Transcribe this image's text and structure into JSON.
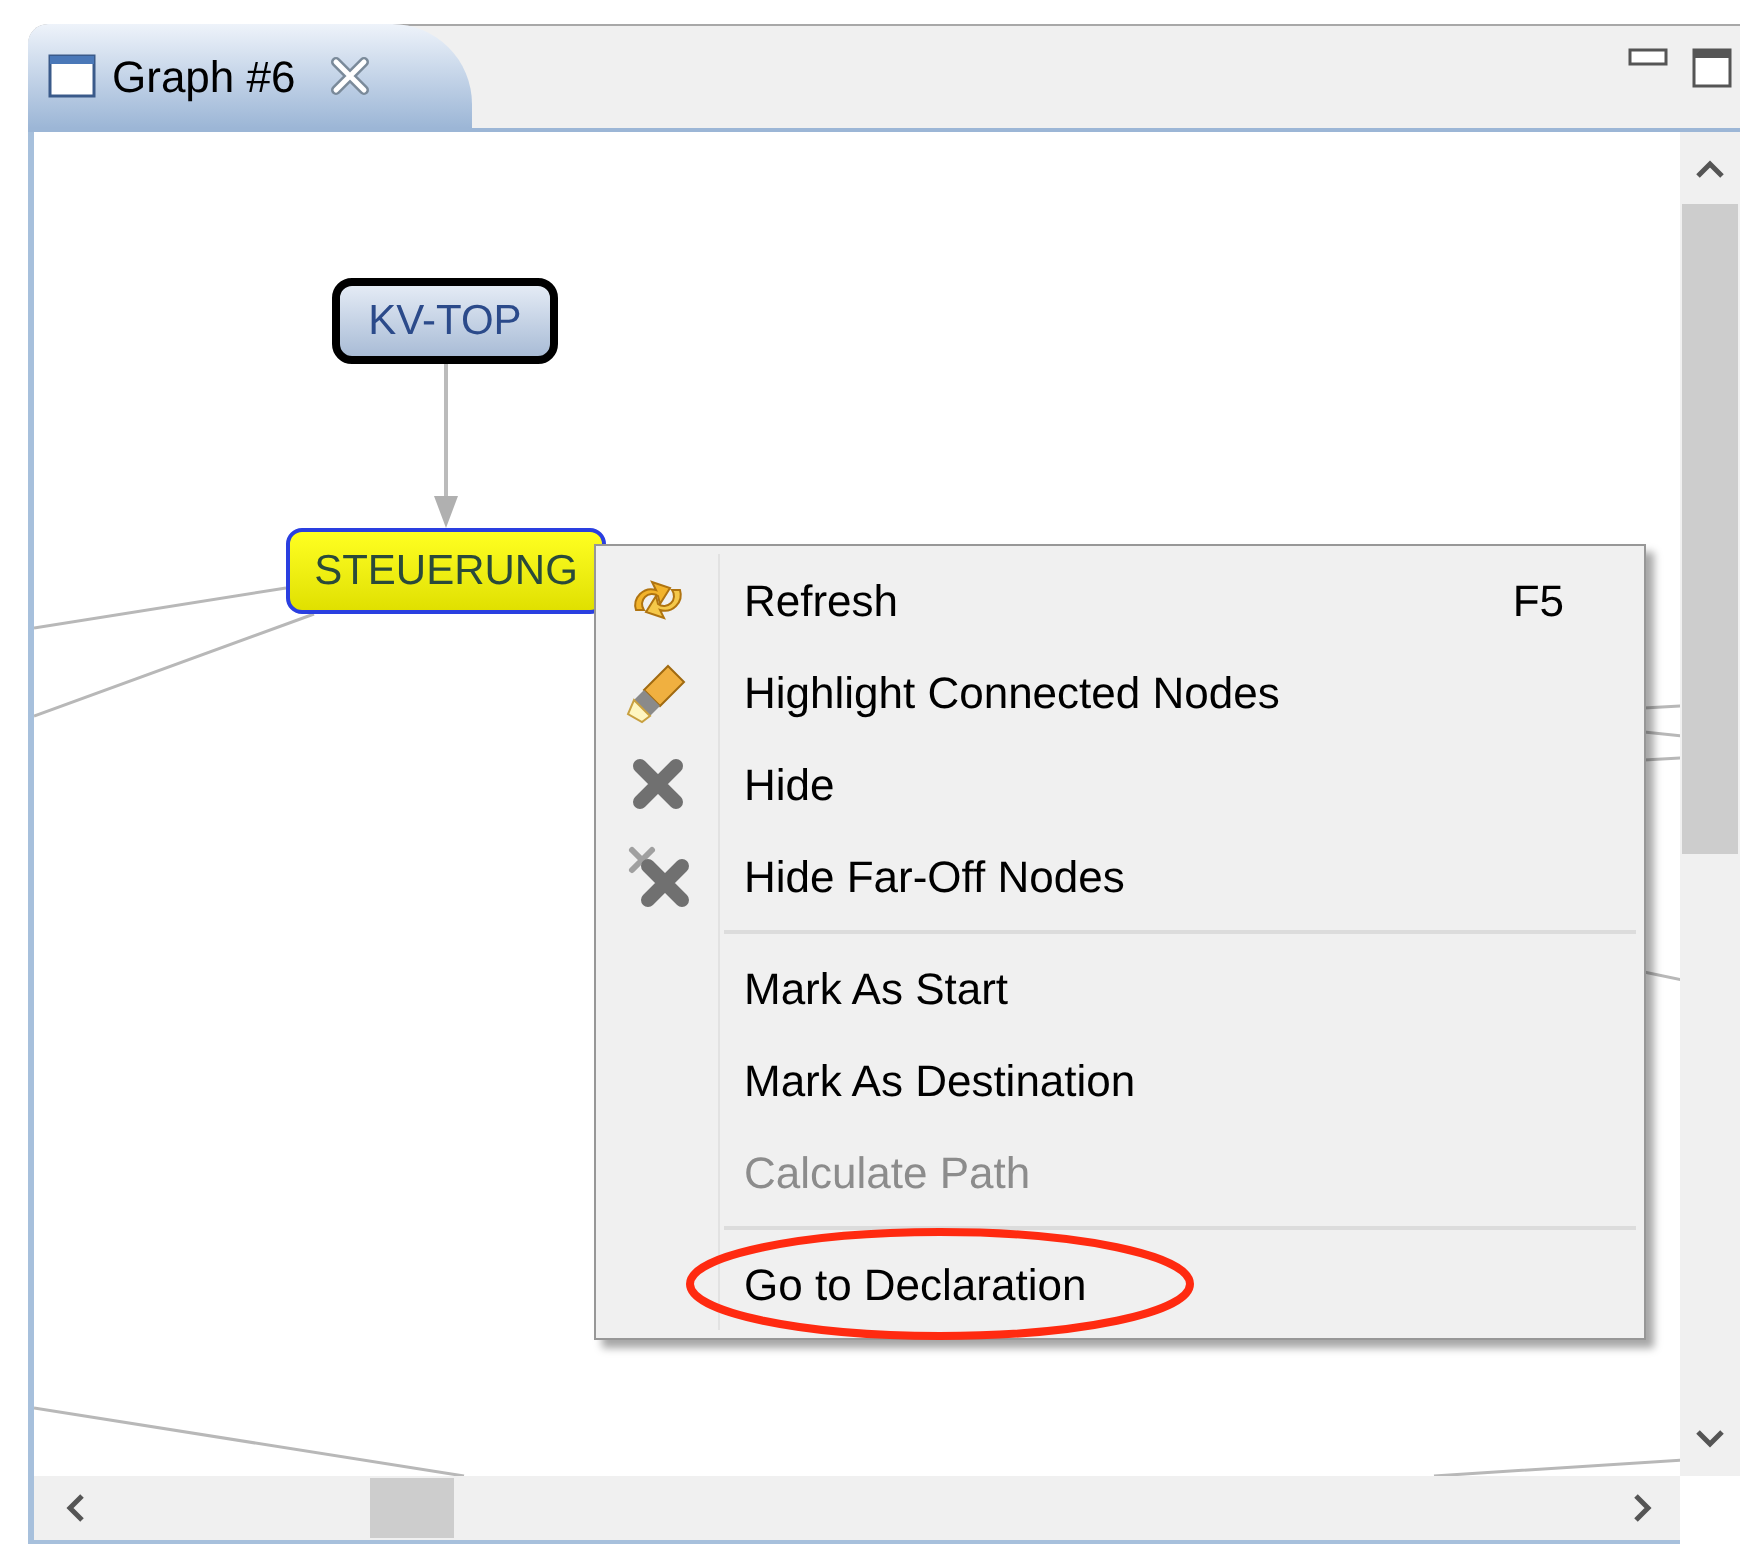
{
  "tab": {
    "title": "Graph #6",
    "selected": true
  },
  "graph": {
    "nodes": [
      {
        "label": "KV-TOP",
        "kind": "focused"
      },
      {
        "label": "STEUERUNG",
        "kind": "highlighted"
      }
    ]
  },
  "context_menu": {
    "groups": [
      [
        {
          "label": "Refresh",
          "shortcut": "F5",
          "disabled": false
        },
        {
          "label": "Highlight Connected Nodes",
          "disabled": false
        },
        {
          "label": "Hide",
          "disabled": false
        },
        {
          "label": "Hide Far-Off Nodes",
          "disabled": false
        }
      ],
      [
        {
          "label": "Mark As Start",
          "disabled": false
        },
        {
          "label": "Mark As Destination",
          "disabled": false
        },
        {
          "label": "Calculate Path",
          "disabled": true
        }
      ],
      [
        {
          "label": "Go to Declaration",
          "disabled": false,
          "circled": true
        }
      ]
    ]
  }
}
